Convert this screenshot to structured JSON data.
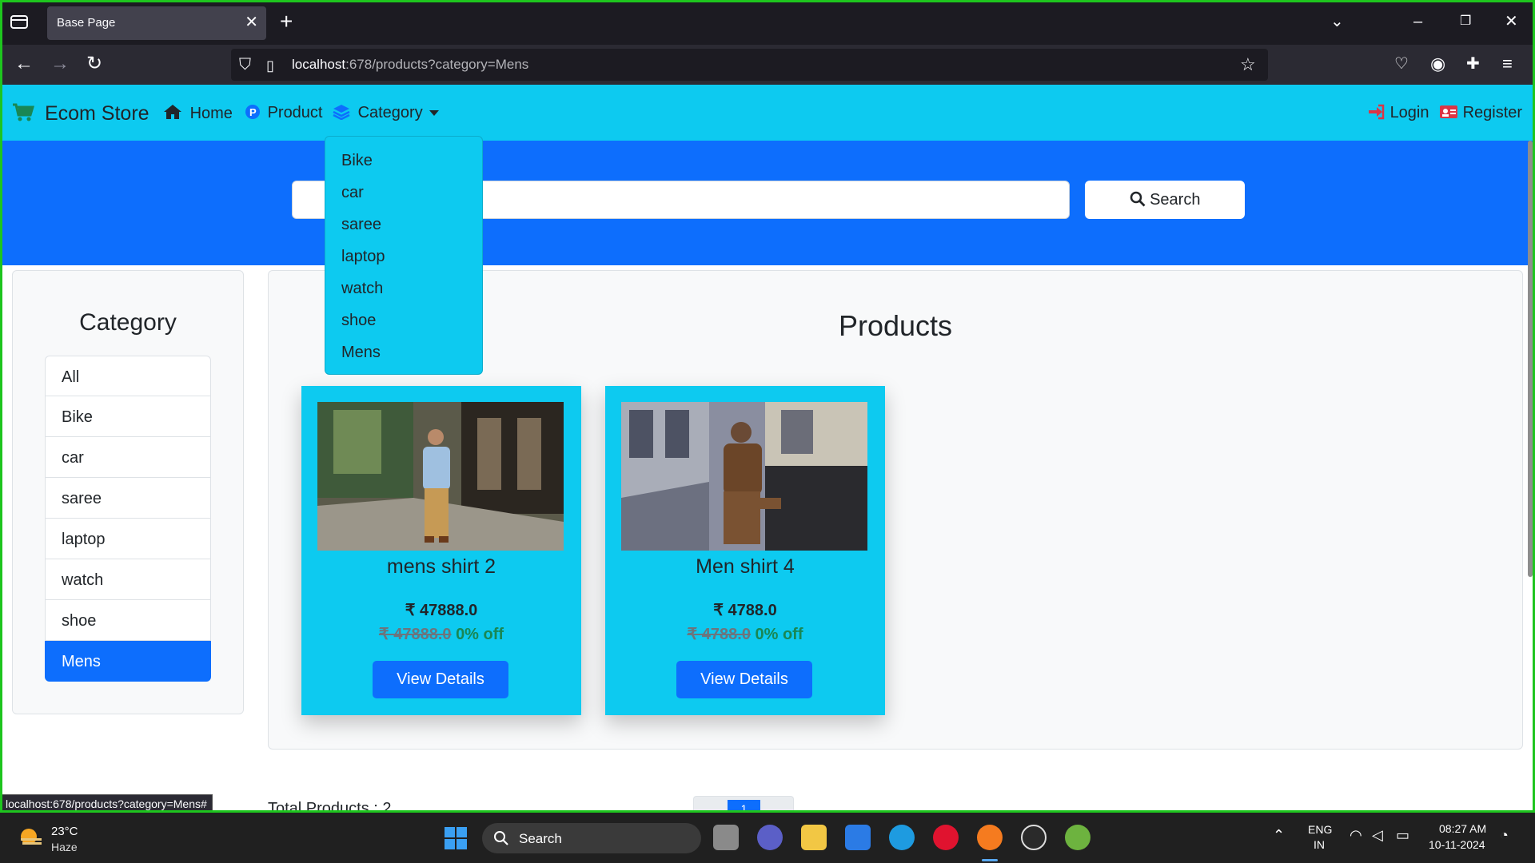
{
  "browser": {
    "tab_title": "Base Page",
    "tab_close": "✕",
    "new_tab": "+",
    "url_host": "localhost",
    "url_path": ":678/products?category=Mens",
    "status_url": "localhost:678/products?category=Mens#"
  },
  "app_nav": {
    "brand": "Ecom Store",
    "home": "Home",
    "product": "Product",
    "category": "Category",
    "login": "Login",
    "register": "Register"
  },
  "dropdown": {
    "items": [
      "Bike",
      "car",
      "saree",
      "laptop",
      "watch",
      "shoe",
      "Mens"
    ]
  },
  "search": {
    "placeholder": "",
    "button": "Search"
  },
  "sidebar": {
    "title": "Category",
    "items": [
      "All",
      "Bike",
      "car",
      "saree",
      "laptop",
      "watch",
      "shoe",
      "Mens"
    ],
    "active": "Mens"
  },
  "products": {
    "title": "Products",
    "items": [
      {
        "name": "mens shirt 2",
        "price": "₹ 47888.0",
        "old_price": "₹ 47888.0",
        "discount": "0% off",
        "button": "View Details"
      },
      {
        "name": "Men shirt 4",
        "price": "₹ 4788.0",
        "old_price": "₹ 4788.0",
        "discount": "0% off",
        "button": "View Details"
      }
    ],
    "total": "Total Products : 2",
    "page": "1"
  },
  "taskbar": {
    "temp": "23°C",
    "condition": "Haze",
    "search": "Search",
    "lang_1": "ENG",
    "lang_2": "IN",
    "time": "08:27 AM",
    "date": "10-11-2024"
  },
  "colors": {
    "navbar": "#0dcaf0",
    "hero": "#0d6efd",
    "active": "#0d6efd",
    "frame": "#1ec51e"
  }
}
